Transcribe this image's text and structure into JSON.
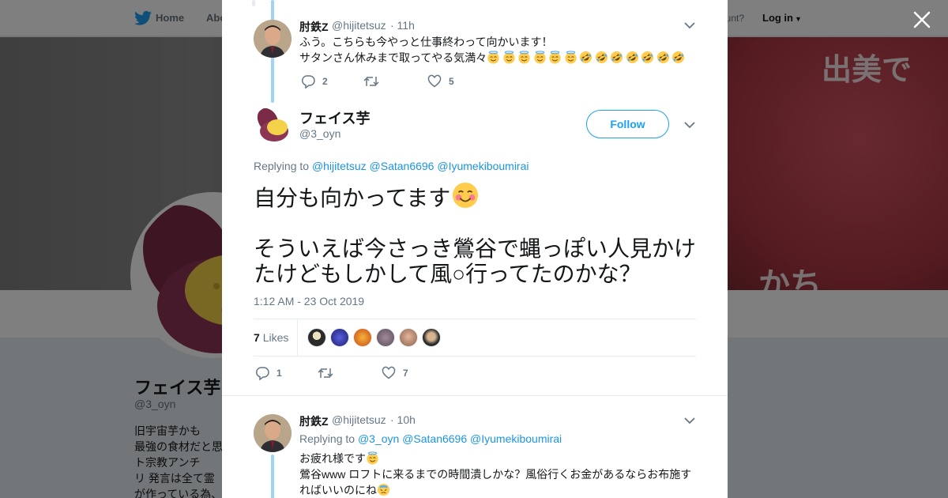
{
  "bg": {
    "nav_home": "Home",
    "nav_about": "Abo",
    "nav_account": "ccount?",
    "nav_login": "Log in",
    "banner_text_1": "出美で",
    "banner_text_2": "かち",
    "profile_name": "フェイス芋",
    "profile_handle": "@3_oyn",
    "bio_lines": [
      "旧宇宙芋かも",
      "最強の食材だと思",
      "ト宗教アンチ",
      "リ 発言は全て霊",
      "が作っている為、"
    ]
  },
  "modal": {
    "tweet1": {
      "name": "肘鉄Z",
      "handle": "@hijitetsuz",
      "time": "· 11h",
      "line1": "ふう。こちらも今やっと仕事終わって向かいます！",
      "line2": "サタンさん休みまで取ってやる気満々",
      "emoji_angel_count": 6,
      "emoji_rofl_count": 7,
      "replies": "2",
      "retweets": "",
      "likes": "5"
    },
    "main": {
      "name": "フェイス芋",
      "handle": "@3_oyn",
      "follow_label": "Follow",
      "replying_to": "Replying to",
      "mentions": [
        "@hijitetsuz",
        "@Satan6696",
        "@Iyumekiboumirai"
      ],
      "line1": "自分も向かってます",
      "line2": "そういえば今さっき鶯谷で蝿っぽい人見かけ",
      "line3": "たけどもしかして風○行ってたのかな？",
      "date": "1:12 AM - 23 Oct 2019",
      "likes_number": "7",
      "likes_label": "Likes",
      "replies": "1",
      "retweets": "",
      "likes": "7"
    },
    "tweet3": {
      "name": "肘鉄Z",
      "handle": "@hijitetsuz",
      "time": "· 10h",
      "replying_to": "Replying to",
      "mentions": [
        "@3_oyn",
        "@Satan6696",
        "@Iyumekiboumirai"
      ],
      "line1": "お疲れ様です",
      "line2": "鶯谷www ロフトに来るまでの時間潰しかな？風俗行くお金があるならお布施す",
      "line3": "ればいいのにね"
    }
  },
  "colors": {
    "accent": "#1da1f2",
    "link": "#1b95e0",
    "thread": "#9fd4f5",
    "muted": "#657786"
  }
}
